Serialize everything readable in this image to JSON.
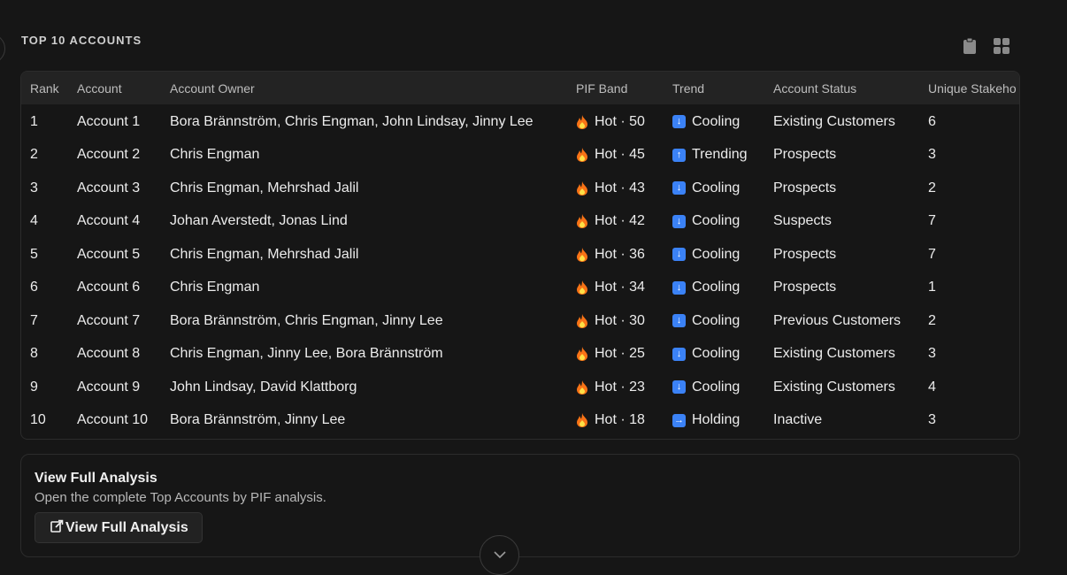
{
  "section": {
    "title": "TOP 10 ACCOUNTS"
  },
  "toolbar": {
    "icons": [
      "clipboard-icon",
      "grid-icon"
    ]
  },
  "table": {
    "headers": [
      "Rank",
      "Account",
      "Account Owner",
      "PIF Band",
      "Trend",
      "Account Status",
      "Unique Stakeho"
    ],
    "rows": [
      {
        "rank": "1",
        "account": "Account 1",
        "owner": "Bora Brännström, Chris Engman, John Lindsay, Jinny Lee",
        "band": "Hot · 50",
        "trend_icon": "↓",
        "trend": "Cooling",
        "status": "Existing Customers",
        "stakeholders": "6"
      },
      {
        "rank": "2",
        "account": "Account 2",
        "owner": "Chris Engman",
        "band": "Hot · 45",
        "trend_icon": "↑",
        "trend": "Trending",
        "status": "Prospects",
        "stakeholders": "3"
      },
      {
        "rank": "3",
        "account": "Account 3",
        "owner": "Chris Engman, Mehrshad Jalil",
        "band": "Hot · 43",
        "trend_icon": "↓",
        "trend": "Cooling",
        "status": "Prospects",
        "stakeholders": "2"
      },
      {
        "rank": "4",
        "account": "Account 4",
        "owner": "Johan Averstedt, Jonas Lind",
        "band": "Hot · 42",
        "trend_icon": "↓",
        "trend": "Cooling",
        "status": "Suspects",
        "stakeholders": "7"
      },
      {
        "rank": "5",
        "account": "Account 5",
        "owner": "Chris Engman, Mehrshad Jalil",
        "band": "Hot · 36",
        "trend_icon": "↓",
        "trend": "Cooling",
        "status": "Prospects",
        "stakeholders": "7"
      },
      {
        "rank": "6",
        "account": "Account 6",
        "owner": "Chris Engman",
        "band": "Hot · 34",
        "trend_icon": "↓",
        "trend": "Cooling",
        "status": "Prospects",
        "stakeholders": "1"
      },
      {
        "rank": "7",
        "account": "Account 7",
        "owner": "Bora Brännström, Chris Engman, Jinny Lee",
        "band": "Hot · 30",
        "trend_icon": "↓",
        "trend": "Cooling",
        "status": "Previous Customers",
        "stakeholders": "2"
      },
      {
        "rank": "8",
        "account": "Account 8",
        "owner": "Chris Engman, Jinny Lee, Bora Brännström",
        "band": "Hot · 25",
        "trend_icon": "↓",
        "trend": "Cooling",
        "status": "Existing Customers",
        "stakeholders": "3"
      },
      {
        "rank": "9",
        "account": "Account 9",
        "owner": "John Lindsay, David Klattborg",
        "band": "Hot · 23",
        "trend_icon": "↓",
        "trend": "Cooling",
        "status": "Existing Customers",
        "stakeholders": "4"
      },
      {
        "rank": "10",
        "account": "Account 10",
        "owner": "Bora Brännström, Jinny Lee",
        "band": "Hot · 18",
        "trend_icon": "→",
        "trend": "Holding",
        "status": "Inactive",
        "stakeholders": "3"
      }
    ]
  },
  "card": {
    "title": "View Full Analysis",
    "description": "Open the complete Top Accounts by PIF analysis.",
    "button_label": "View Full Analysis",
    "button_icon": "external-link-icon"
  },
  "colors": {
    "background": "#161616",
    "header_row": "#232323",
    "trend_icon_bg": "#3b82f6",
    "flame": "#f97316"
  }
}
